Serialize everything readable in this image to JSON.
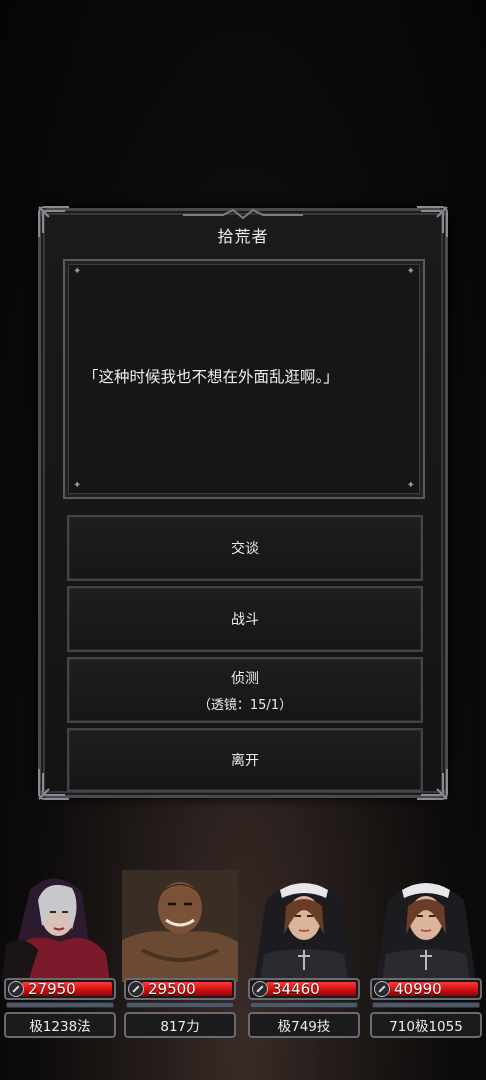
{
  "dialog": {
    "title": "拾荒者",
    "message": "「这种时候我也不想在外面乱逛啊。」",
    "options": {
      "talk": "交谈",
      "fight": "战斗",
      "detect": "侦测",
      "detect_sub": "（透镜：15/1）",
      "leave": "离开"
    }
  },
  "party": [
    {
      "hp": "27950",
      "stat": "极1238法",
      "icon": "sorceress-portrait"
    },
    {
      "hp": "29500",
      "stat": "817力",
      "icon": "brute-portrait"
    },
    {
      "hp": "34460",
      "stat": "极749技",
      "icon": "nun-portrait"
    },
    {
      "hp": "40990",
      "stat": "710极1055",
      "icon": "nun-portrait"
    }
  ],
  "colors": {
    "hp_bar": "#d01010",
    "frame": "#6a6a70",
    "text": "#f0ece6"
  }
}
